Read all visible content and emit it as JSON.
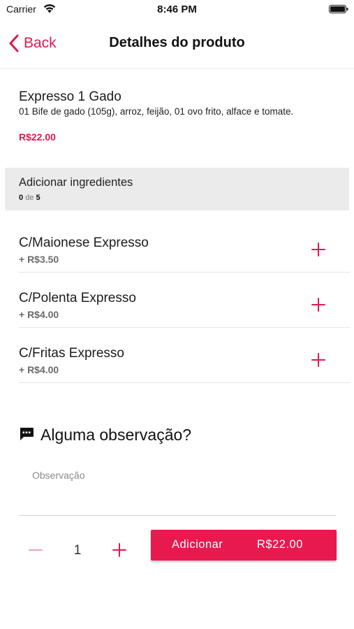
{
  "status_bar": {
    "carrier": "Carrier",
    "time": "8:46 PM",
    "wifi_icon": "wifi-icon",
    "battery_icon": "battery-icon"
  },
  "nav": {
    "back_label": "Back",
    "back_icon": "chevron-left-icon",
    "title": "Detalhes do produto"
  },
  "product": {
    "name": "Expresso 1 Gado",
    "description": "01 Bife de gado (105g), arroz, feijão, 01 ovo frito, alface e tomate.",
    "price": "R$22.00"
  },
  "ingredients": {
    "title": "Adicionar ingredientes",
    "selected": "0",
    "of_label": "de",
    "max": "5",
    "items": [
      {
        "name": "C/Maionese Expresso",
        "price": "+ R$3.50"
      },
      {
        "name": "C/Polenta Expresso",
        "price": "+ R$4.00"
      },
      {
        "name": "C/Fritas Expresso",
        "price": "+ R$4.00"
      }
    ]
  },
  "observation": {
    "icon": "comment-icon",
    "title": "Alguma observação?",
    "placeholder": "Observação",
    "value": ""
  },
  "footer": {
    "quantity": "1",
    "add_label": "Adicionar",
    "add_price": "R$22.00"
  },
  "colors": {
    "accent": "#e0194f",
    "button": "#e8194f",
    "section_bg": "#ebebeb"
  }
}
